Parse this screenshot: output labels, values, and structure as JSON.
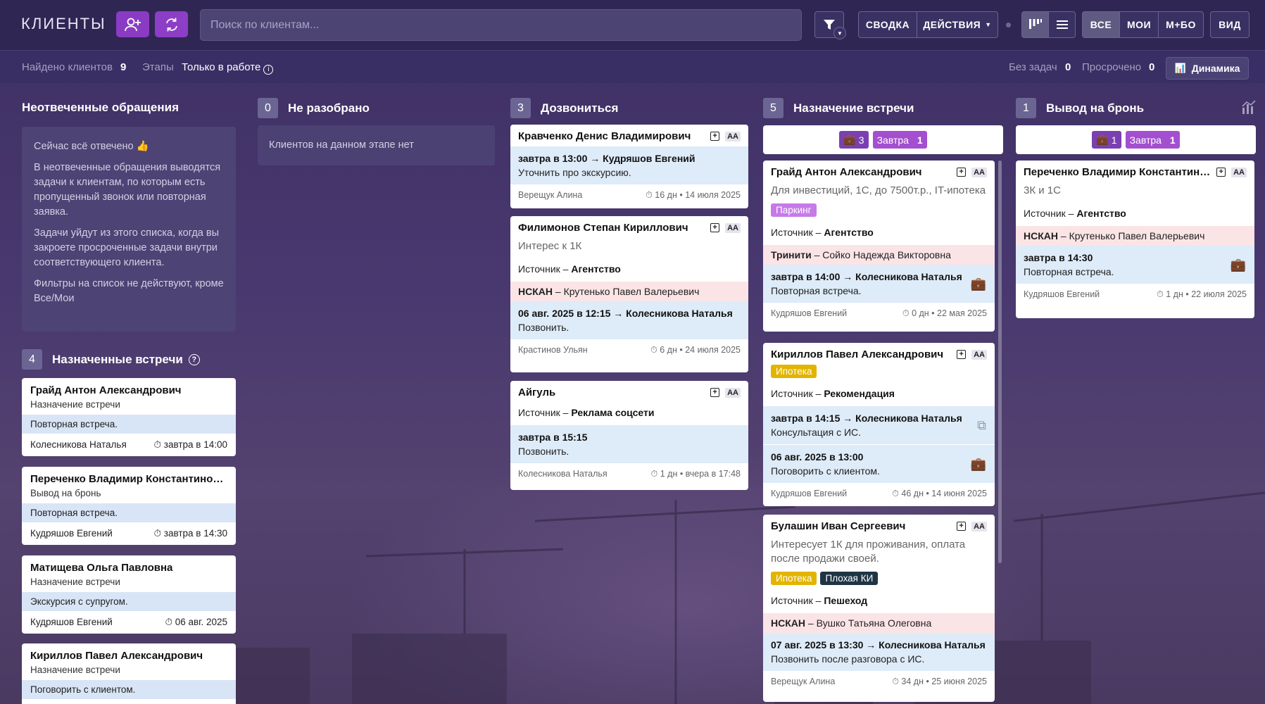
{
  "app": {
    "title": "КЛИЕНТЫ",
    "search_placeholder": "Поиск по клиентам..."
  },
  "toolbar": {
    "summary": "СВОДКА",
    "actions": "ДЕЙСТВИЯ",
    "all": "ВСЕ",
    "mine": "МОИ",
    "mbo": "М+БО",
    "view": "ВИД",
    "accent": "#8a3bc4"
  },
  "subbar": {
    "found_label": "Найдено клиентов",
    "found_count": "9",
    "stages_label": "Этапы",
    "stages_value": "Только в работе",
    "no_tasks_label": "Без задач",
    "no_tasks_count": "0",
    "overdue_label": "Просрочено",
    "overdue_count": "0",
    "dynamics": "Динамика"
  },
  "unanswered": {
    "title": "Неотвеченные обращения",
    "p1": "Сейчас всё отвечено 👍",
    "p2": "В неотвеченные обращения выводятся задачи к клиентам, по которым есть пропущенный звонок или повторная заявка.",
    "p3": "Задачи уйдут из этого списка, когда вы закроете просроченные задачи внутри соответствующего клиента.",
    "p4": "Фильтры на список не действуют, кроме Все/Мои"
  },
  "meetings": {
    "count": "4",
    "title": "Назначенные встречи",
    "items": [
      {
        "name": "Грайд Антон Александрович",
        "stage": "Назначение встречи",
        "note": "Повторная встреча.",
        "who": "Колесникова Наталья",
        "when": "завтра в 14:00"
      },
      {
        "name": "Переченко Владимир Константинович",
        "stage": "Вывод на бронь",
        "note": "Повторная встреча.",
        "who": "Кудряшов Евгений",
        "when": "завтра в 14:30"
      },
      {
        "name": "Матищева Ольга Павловна",
        "stage": "Назначение встречи",
        "note": "Экскурсия с супругом.",
        "who": "Кудряшов Евгений",
        "when": "06 авг. 2025"
      },
      {
        "name": "Кириллов Павел Александрович",
        "stage": "Назначение встречи",
        "note": "Поговорить с клиентом."
      }
    ]
  },
  "columns": {
    "c1": {
      "count": "0",
      "title": "Не разобрано",
      "empty": "Клиентов на данном этапе нет"
    },
    "c2": {
      "count": "3",
      "title": "Дозвониться"
    },
    "c3": {
      "count": "5",
      "title": "Назначение встречи",
      "brief": "3",
      "tomorrow": "Завтра",
      "tomorrow_n": "1"
    },
    "c4": {
      "count": "1",
      "title": "Вывод на бронь",
      "brief": "1",
      "tomorrow": "Завтра",
      "tomorrow_n": "1"
    }
  },
  "cards": {
    "k1": {
      "name": "Кравченко Денис Владимирович",
      "task_b": "завтра в 13:00 → Кудряшов Евгений",
      "task": "Уточнить про экскурсию.",
      "who": "Верещук Алина",
      "meta": "16 дн • 14 июля 2025"
    },
    "k2": {
      "name": "Филимонов Степан Кириллович",
      "desc": "Интерес к 1К",
      "src_l": "Источник – ",
      "src": "Агентство",
      "agent_b": "НСКАН",
      "agent": " – Крутенько Павел Валерьевич",
      "task_b": "06 авг. 2025 в 12:15 → Колесникова Наталья",
      "task": "Позвонить.",
      "who": "Крастинов Ульян",
      "meta": "6 дн • 24 июля 2025"
    },
    "k3": {
      "name": "Айгуль",
      "src_l": "Источник – ",
      "src": "Реклама соцсети",
      "task_b": "завтра в 15:15",
      "task": "Позвонить.",
      "who": "Колесникова Наталья",
      "meta": "1 дн • вчера в 17:48"
    },
    "k4": {
      "name": "Грайд Антон Александрович",
      "desc": "Для инвестиций, 1С, до 7500т.р., IT-ипотека",
      "tag1": "Паркинг",
      "src_l": "Источник – ",
      "src": "Агентство",
      "agent_b": "Тринити",
      "agent": " – Сойко Надежда Викторовна",
      "task_b": "завтра в 14:00 → Колесникова Наталья",
      "task": "Повторная встреча.",
      "who": "Кудряшов Евгений",
      "meta": "0 дн • 22 мая 2025"
    },
    "k5": {
      "name": "Кириллов Павел Александрович",
      "tag1": "Ипотека",
      "src_l": "Источник – ",
      "src": "Рекомендация",
      "task_b": "завтра в 14:15 → Колесникова Наталья",
      "task": "Консультация с ИС.",
      "task2_b": "06 авг. 2025 в 13:00",
      "task2": "Поговорить с клиентом.",
      "who": "Кудряшов Евгений",
      "meta": "46 дн • 14 июня 2025"
    },
    "k6": {
      "name": "Булашин Иван Сергеевич",
      "desc": "Интересует 1К для проживания, оплата после продажи своей.",
      "tag1": "Ипотека",
      "tag2": "Плохая КИ",
      "src_l": "Источник – ",
      "src": "Пешеход",
      "agent_b": "НСКАН",
      "agent": " – Вушко Татьяна Олеговна",
      "task_b": "07 авг. 2025 в 13:30 → Колесникова Наталья",
      "task": "Позвонить после разговора с ИС.",
      "who": "Верещук Алина",
      "meta": "34 дн • 25 июня 2025"
    },
    "k7": {
      "name": "Переченко Владимир Константинович",
      "desc": "3К и 1С",
      "src_l": "Источник – ",
      "src": "Агентство",
      "agent_b": "НСКАН",
      "agent": " – Крутенько Павел Валерьевич",
      "task_b": "завтра в 14:30",
      "task": "Повторная встреча.",
      "who": "Кудряшов Евгений",
      "meta": "1 дн • 22 июля 2025"
    }
  },
  "aa": "АА"
}
